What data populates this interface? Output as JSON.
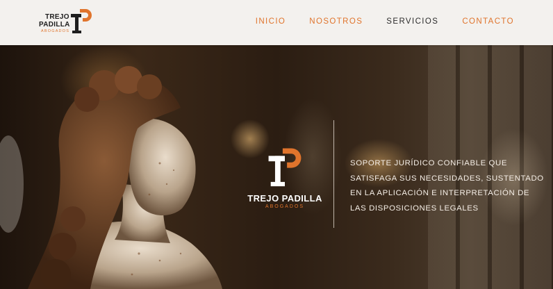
{
  "brand": {
    "name_line1": "TREJO",
    "name_line2": "PADILLA",
    "full_name": "TREJO PADILLA",
    "subtitle": "ABOGADOS",
    "accent_color": "#e0742c",
    "dark_color": "#1e1e1e"
  },
  "nav": {
    "items": [
      {
        "label": "INICIO",
        "color": "#e0742c"
      },
      {
        "label": "NOSOTROS",
        "color": "#e0742c"
      },
      {
        "label": "SERVICIOS",
        "color": "#2b2b2b"
      },
      {
        "label": "CONTACTO",
        "color": "#e0742c"
      }
    ]
  },
  "hero": {
    "tagline_lines": [
      "SOPORTE JURÍDICO CONFIABLE QUE",
      "SATISFAGA SUS NECESIDADES, SUSTENTADO",
      "EN LA APLICACIÓN E INTERPRETACIÓN DE",
      "LAS DISPOSICIONES LEGALES"
    ],
    "image_subject": "marble-bust-statue-photo"
  }
}
